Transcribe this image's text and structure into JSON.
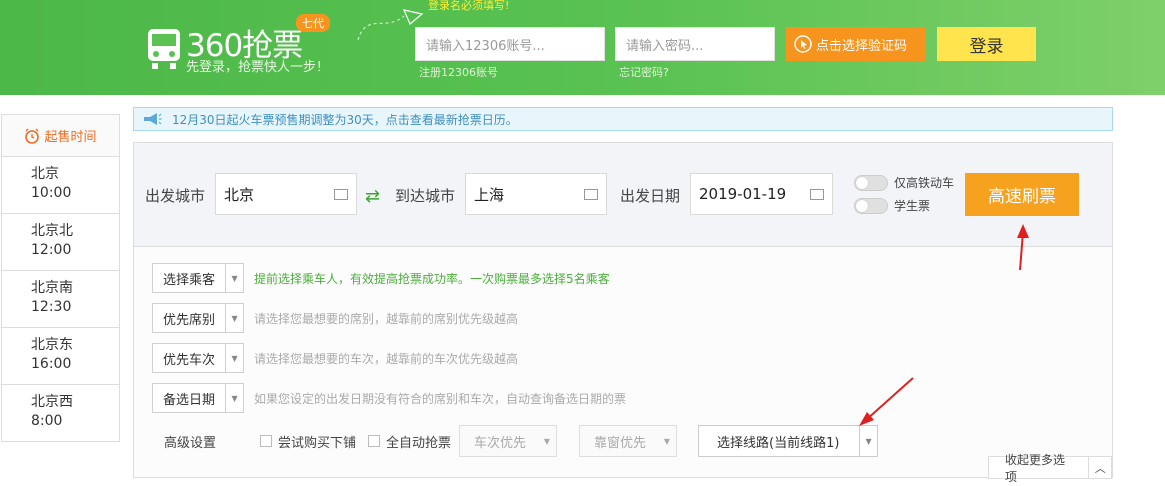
{
  "header": {
    "brand": "360抢票",
    "badge": "七代",
    "slogan": "先登录，抢票快人一步！",
    "login_tip": "登录名必须填写!",
    "username_placeholder": "请输入12306账号...",
    "password_placeholder": "请输入密码...",
    "register_link": "注册12306账号",
    "forgot_link": "忘记密码?",
    "captcha_label": "点击选择验证码",
    "login_label": "登录"
  },
  "sidebar": {
    "title": "起售时间",
    "items": [
      {
        "station": "北京",
        "time": "10:00"
      },
      {
        "station": "北京北",
        "time": "12:00"
      },
      {
        "station": "北京南",
        "time": "12:30"
      },
      {
        "station": "北京东",
        "time": "16:00"
      },
      {
        "station": "北京西",
        "time": "8:00"
      }
    ]
  },
  "notice": "12月30日起火车票预售期调整为30天，点击查看最新抢票日历。",
  "search": {
    "from_label": "出发城市",
    "from_value": "北京",
    "to_label": "到达城市",
    "to_value": "上海",
    "date_label": "出发日期",
    "date_value": "2019-01-19",
    "toggle_highspeed": "仅高铁动车",
    "toggle_student": "学生票",
    "submit_label": "高速刷票"
  },
  "options": [
    {
      "select": "选择乘客",
      "hint": "提前选择乘车人，有效提高抢票成功率。一次购票最多选择5名乘客"
    },
    {
      "select": "优先席别",
      "hint": "请选择您最想要的席别，越靠前的席别优先级越高"
    },
    {
      "select": "优先车次",
      "hint": "请选择您最想要的车次，越靠前的车次优先级越高"
    },
    {
      "select": "备选日期",
      "hint": "如果您设定的出发日期没有符合的席别和车次，自动查询备选日期的票"
    }
  ],
  "advanced": {
    "label": "高级设置",
    "try_lower": "尝试购买下铺",
    "auto_grab": "全自动抢票",
    "train_priority": "车次优先",
    "window_priority": "靠窗优先",
    "route_select": "选择线路(当前线路1)",
    "collapse_label": "收起更多选项"
  },
  "colors": {
    "header_green": "#59c252",
    "accent_orange": "#f7a21e",
    "login_yellow": "#ffe44d",
    "annotation_red": "#e02020"
  }
}
